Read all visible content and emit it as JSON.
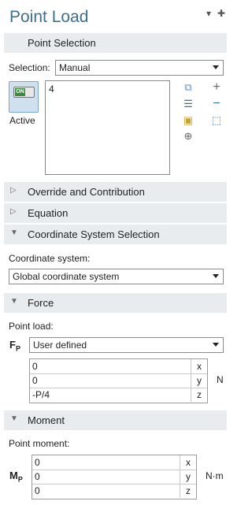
{
  "panel": {
    "title": "Point Load"
  },
  "point_selection": {
    "header": "Point Selection",
    "selection_label": "Selection:",
    "selection_value": "Manual",
    "list_items": [
      "4"
    ],
    "active_label": "Active",
    "toggle_text": "ON"
  },
  "sections": {
    "override": "Override and Contribution",
    "equation": "Equation",
    "coord_sel": "Coordinate System Selection"
  },
  "coordinate": {
    "label": "Coordinate system:",
    "value": "Global coordinate system"
  },
  "force": {
    "header": "Force",
    "label": "Point load:",
    "symbol": "F",
    "subscript": "P",
    "select_value": "User defined",
    "rows": [
      {
        "value": "0",
        "comp": "x"
      },
      {
        "value": "0",
        "comp": "y"
      },
      {
        "value": "-P/4",
        "comp": "z"
      }
    ],
    "unit": "N"
  },
  "moment": {
    "header": "Moment",
    "label": "Point moment:",
    "symbol": "M",
    "subscript": "P",
    "rows": [
      {
        "value": "0",
        "comp": "x"
      },
      {
        "value": "0",
        "comp": "y"
      },
      {
        "value": "0",
        "comp": "z"
      }
    ],
    "unit": "N·m"
  },
  "colors": {
    "title": "#3d6f8f",
    "section_bg": "#e9ecef",
    "active_bg": "#cfe0ef"
  }
}
